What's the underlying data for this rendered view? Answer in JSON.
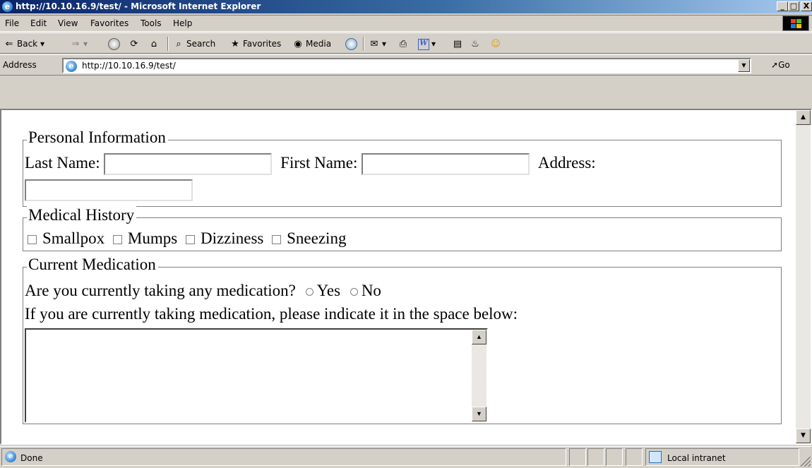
{
  "window": {
    "title": "http://10.10.16.9/test/ - Microsoft Internet Explorer",
    "controls": {
      "minimize": "_",
      "maximize": "□",
      "close": "X"
    }
  },
  "menu": {
    "items": [
      "File",
      "Edit",
      "View",
      "Favorites",
      "Tools",
      "Help"
    ]
  },
  "toolbar": {
    "back": "Back",
    "search": "Search",
    "favorites": "Favorites",
    "media": "Media"
  },
  "address": {
    "label": "Address",
    "url": "http://10.10.16.9/test/",
    "go": "Go"
  },
  "form": {
    "personal": {
      "legend": "Personal Information",
      "last_name_label": "Last Name:",
      "first_name_label": "First Name:",
      "address_label": "Address:",
      "last_name_value": "",
      "first_name_value": "",
      "address_value": ""
    },
    "medical": {
      "legend": "Medical History",
      "options": [
        "Smallpox",
        "Mumps",
        "Dizziness",
        "Sneezing"
      ]
    },
    "medication": {
      "legend": "Current Medication",
      "question": "Are you currently taking any medication?",
      "yes": "Yes",
      "no": "No",
      "instruction": "If you are currently taking medication, please indicate it in the space below:",
      "textarea_value": ""
    }
  },
  "status": {
    "text": "Done",
    "zone": "Local intranet"
  },
  "icons": {
    "ie_logo": "e",
    "scroll_up": "▲",
    "scroll_down": "▼",
    "dropdown": "▼"
  }
}
